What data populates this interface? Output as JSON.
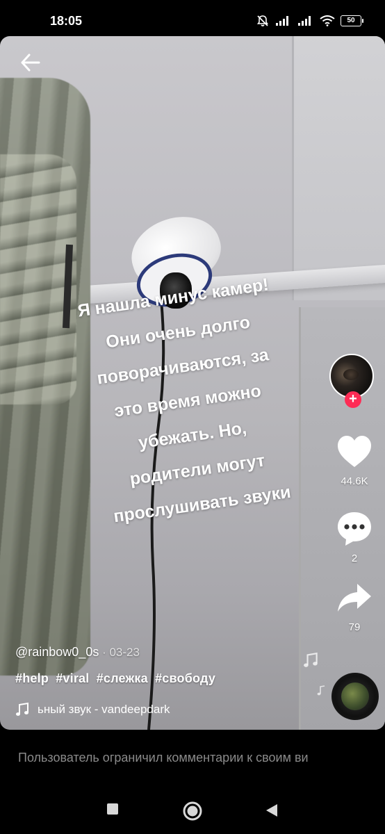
{
  "status_bar": {
    "time": "18:05",
    "battery": "50"
  },
  "video": {
    "overlay_lines": [
      "Я нашла минус камер!",
      "Они очень долго",
      "поворачиваются, за",
      "это время можно",
      "убежать. Но,",
      "родители могут",
      "прослушивать звуки"
    ]
  },
  "actions": {
    "likes": "44.6K",
    "comments": "2",
    "shares": "79",
    "follow_symbol": "+"
  },
  "post": {
    "username": "@rainbow0_0s",
    "date": " · 03-23",
    "hashtags": [
      "#help",
      "#viral",
      "#слежка",
      "#свободу"
    ],
    "music": "ьный звук - vandeepdark"
  },
  "comments_notice": "Пользователь ограничил комментарии к своим ви",
  "colors": {
    "accent": "#fe2c55",
    "text": "#ffffff",
    "muted": "#8a8a8a"
  },
  "icons": {
    "back": "arrow-left-icon",
    "like": "heart-icon",
    "comment": "comment-bubble-icon",
    "share": "share-arrow-icon",
    "music": "music-note-icon",
    "nav_recents": "square-icon",
    "nav_home": "circle-icon",
    "nav_back": "triangle-back-icon"
  }
}
